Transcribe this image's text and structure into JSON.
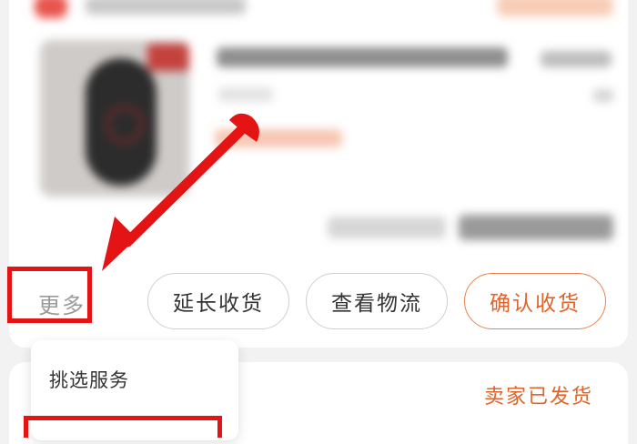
{
  "order_card": {
    "more_label": "更多",
    "actions": {
      "extend_receipt": "延长收货",
      "view_logistics": "查看物流",
      "confirm_receipt": "确认收货"
    }
  },
  "more_menu": {
    "items": [
      "挑选服务"
    ]
  },
  "next_order": {
    "status": "卖家已发货"
  },
  "colors": {
    "accent": "#e0632a",
    "annotation_red": "#e51414"
  }
}
